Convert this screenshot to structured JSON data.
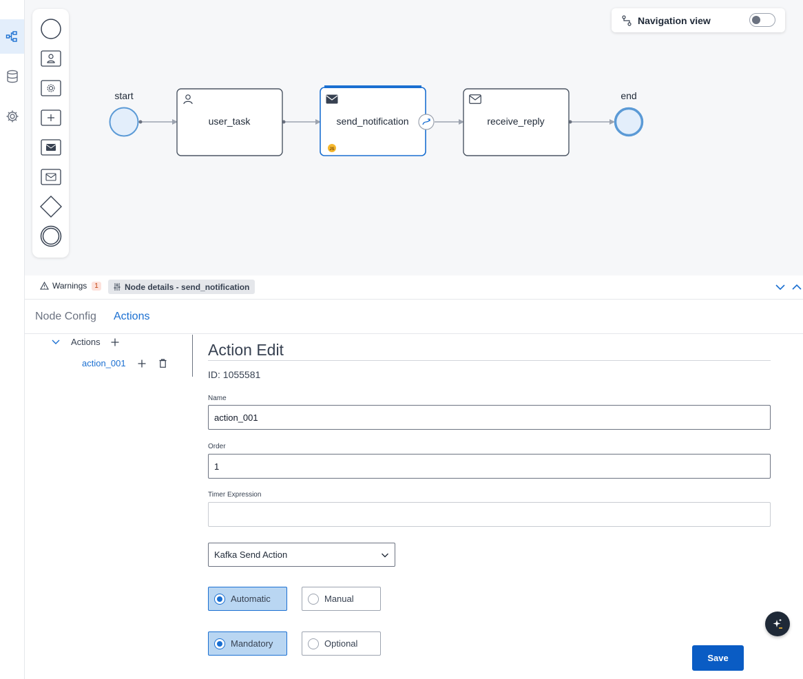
{
  "rail": {
    "items": [
      {
        "icon": "process-tree-icon",
        "active": true
      },
      {
        "icon": "database-icon",
        "active": false
      },
      {
        "icon": "gear-icon",
        "active": false
      }
    ]
  },
  "palette": {
    "tools": [
      "start-event-icon",
      "user-task-icon",
      "service-task-icon",
      "subprocess-icon",
      "send-message-icon",
      "receive-message-icon",
      "gateway-icon",
      "end-event-icon"
    ]
  },
  "navigation_view": {
    "label": "Navigation view",
    "enabled": false
  },
  "diagram": {
    "nodes": [
      {
        "id": "start",
        "label": "start",
        "type": "start-event"
      },
      {
        "id": "user_task",
        "label": "user_task",
        "type": "user-task"
      },
      {
        "id": "send_notification",
        "label": "send_notification",
        "type": "send-task",
        "selected": true,
        "badge": "JS"
      },
      {
        "id": "receive_reply",
        "label": "receive_reply",
        "type": "receive-task"
      },
      {
        "id": "end",
        "label": "end",
        "type": "end-event"
      }
    ]
  },
  "strip": {
    "warnings_label": "Warnings",
    "warnings_count": "1",
    "node_details_label": "Node details - send_notification"
  },
  "tabs": {
    "node_config": "Node Config",
    "actions": "Actions",
    "active": "Actions"
  },
  "tree": {
    "root_label": "Actions",
    "child_label": "action_001"
  },
  "form": {
    "title": "Action Edit",
    "id_text": "ID: 1055581",
    "name_label": "Name",
    "name_value": "action_001",
    "order_label": "Order",
    "order_value": "1",
    "timer_label": "Timer Expression",
    "timer_value": "",
    "action_type": "Kafka Send Action",
    "trigger_options": [
      {
        "label": "Automatic",
        "checked": true
      },
      {
        "label": "Manual",
        "checked": false
      }
    ],
    "required_options": [
      {
        "label": "Mandatory",
        "checked": true
      },
      {
        "label": "Optional",
        "checked": false
      }
    ],
    "save_label": "Save"
  },
  "colors": {
    "accent": "#1a6fd1",
    "save": "#0a5cc4",
    "canvas": "#f6f7f9",
    "badge_js": "#f5b82e"
  }
}
